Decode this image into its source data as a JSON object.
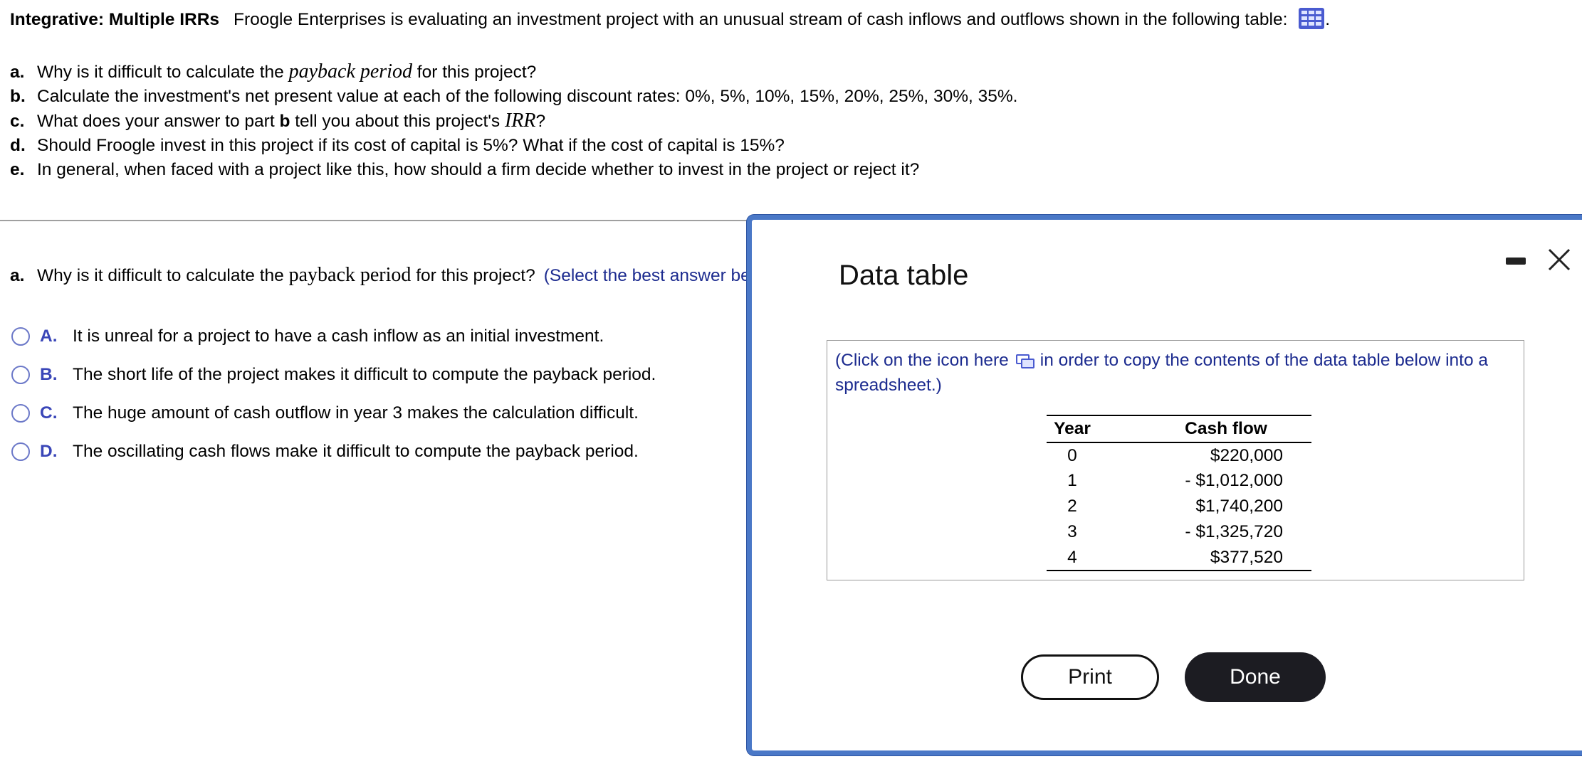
{
  "header": {
    "title": "Integrative:  Multiple IRRs",
    "intro_text": "Froogle Enterprises is evaluating an investment project with an unusual stream of cash inflows and outflows shown in the following table:",
    "intro_tail": ".",
    "table_icon": "table-grid-icon"
  },
  "questions": [
    {
      "letter": "a.",
      "pre": "Why is it difficult to calculate the ",
      "em": "payback period",
      "post": " for this project?"
    },
    {
      "letter": "b.",
      "pre": "Calculate the investment's net present value at each of the following discount rates: 0%, 5%, 10%, 15%, 20%, 25%, 30%, 35%.",
      "em": "",
      "post": ""
    },
    {
      "letter": "c.",
      "pre": "What does your answer to part ",
      "bold": "b",
      "mid": " tell you about this project's ",
      "em": "IRR",
      "post": "?"
    },
    {
      "letter": "d.",
      "pre": "Should Froogle invest in this project if its cost of capital is 5%?  What if the cost of capital is 15%?",
      "em": "",
      "post": ""
    },
    {
      "letter": "e.",
      "pre": "In general, when faced with a project like this, how should a firm decide whether to invest in the project or reject it?",
      "em": "",
      "post": ""
    }
  ],
  "part_a": {
    "letter": "a.",
    "pre": "Why is it difficult to calculate the ",
    "serif": "payback period",
    "post": " for this project?",
    "hint": "(Select the best answer below.)",
    "options": [
      {
        "letter": "A.",
        "text": "It is unreal for a project to have a cash inflow as an initial investment."
      },
      {
        "letter": "B.",
        "text": "The short life of the project makes it difficult to compute the payback period."
      },
      {
        "letter": "C.",
        "text": "The huge amount of cash outflow in year 3 makes the calculation difficult."
      },
      {
        "letter": "D.",
        "text": "The oscillating cash flows make it difficult to compute the payback period."
      }
    ]
  },
  "modal": {
    "title": "Data table",
    "copy_note_pre": "(Click on the icon here",
    "copy_note_post": "in order to copy the contents of the data table below into a spreadsheet.)",
    "table": {
      "headers": [
        "Year",
        "Cash flow"
      ],
      "rows": [
        [
          "0",
          "$220,000"
        ],
        [
          "1",
          "- $1,012,000"
        ],
        [
          "2",
          "$1,740,200"
        ],
        [
          "3",
          "- $1,325,720"
        ],
        [
          "4",
          "$377,520"
        ]
      ]
    },
    "print_label": "Print",
    "done_label": "Done",
    "accent_color": "#4a78c7",
    "link_color": "#1c2b8f"
  }
}
